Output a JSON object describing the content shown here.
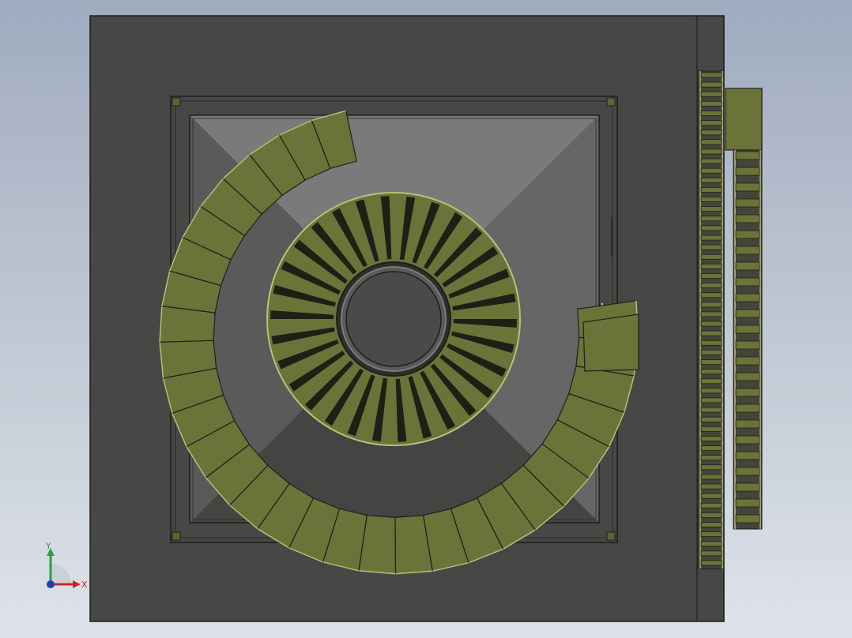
{
  "view": {
    "background_top": "#9fabbf",
    "background_bottom": "#dfe3e9"
  },
  "model": {
    "slab_color": "#474745",
    "recess_color": "#6a6a6a",
    "stair_color": "#6b7338",
    "stair_edge_color": "#b9c07a",
    "outline_color": "#1f1f1c"
  },
  "triad": {
    "x_label": "X",
    "y_label": "Y",
    "x_color": "#c62828",
    "y_color": "#2e9e3e",
    "z_color": "#1e3fb0"
  }
}
